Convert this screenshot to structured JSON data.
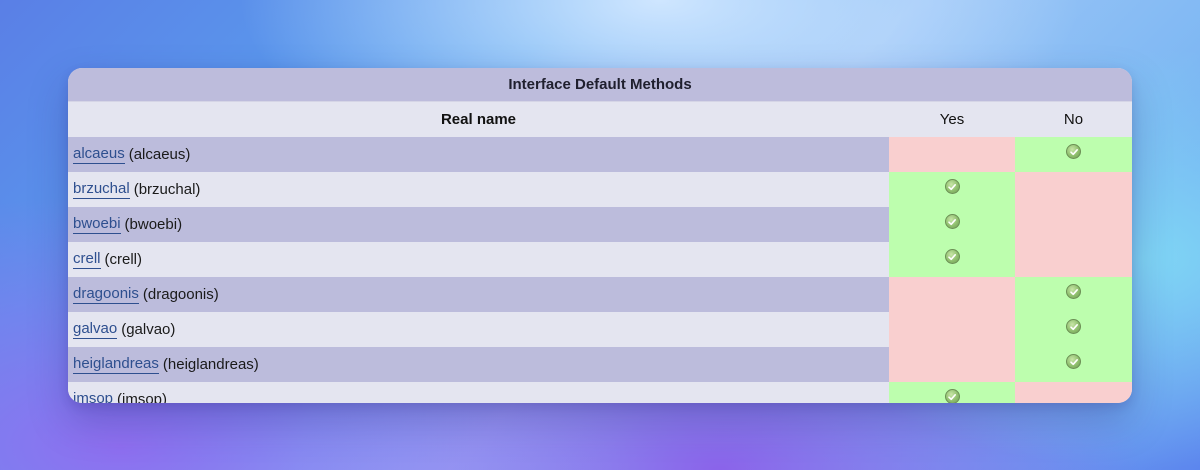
{
  "table": {
    "title": "Interface Default Methods",
    "headers": {
      "name": "Real name",
      "yes": "Yes",
      "no": "No"
    },
    "rows": [
      {
        "link": "alcaeus",
        "alias": "(alcaeus)",
        "yes": false
      },
      {
        "link": "brzuchal",
        "alias": "(brzuchal)",
        "yes": true
      },
      {
        "link": "bwoebi",
        "alias": "(bwoebi)",
        "yes": true
      },
      {
        "link": "crell",
        "alias": "(crell)",
        "yes": true
      },
      {
        "link": "dragoonis",
        "alias": "(dragoonis)",
        "yes": false
      },
      {
        "link": "galvao",
        "alias": "(galvao)",
        "yes": false
      },
      {
        "link": "heiglandreas",
        "alias": "(heiglandreas)",
        "yes": false
      },
      {
        "link": "imsop",
        "alias": "(imsop)",
        "yes": true
      }
    ],
    "colors": {
      "yes_cell": "#bdfeae",
      "no_cell": "#f9cfcf",
      "link": "#2e4f8f"
    },
    "check_icon": "check-circle-icon"
  }
}
